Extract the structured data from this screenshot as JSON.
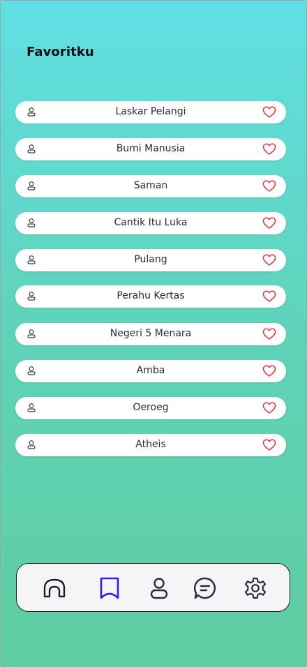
{
  "header": {
    "title": "Favoritku"
  },
  "favorites": [
    {
      "title": "Laskar Pelangi"
    },
    {
      "title": "Bumi Manusia"
    },
    {
      "title": "Saman"
    },
    {
      "title": "Cantik Itu Luka"
    },
    {
      "title": "Pulang"
    },
    {
      "title": "Perahu Kertas"
    },
    {
      "title": "Negeri 5 Menara"
    },
    {
      "title": "Amba"
    },
    {
      "title": "Oeroeg"
    },
    {
      "title": "Atheis"
    }
  ],
  "icons": {
    "user": "user-icon",
    "heart": "heart-icon",
    "home": "home-icon",
    "bookmark": "bookmark-icon",
    "profile": "profile-icon",
    "chat": "chat-icon",
    "settings": "gear-icon"
  },
  "nav": {
    "active": "bookmark"
  },
  "colors": {
    "heart": "#e8262f",
    "active_nav": "#2a20e8",
    "nav_icon": "#2a2a3c",
    "gradient_top": "#61dfe4",
    "gradient_bottom": "#5fcda0"
  }
}
